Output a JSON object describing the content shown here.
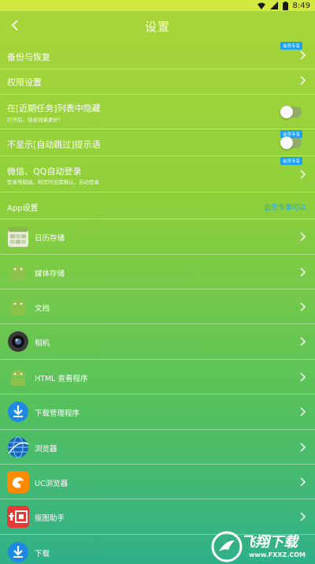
{
  "status": {
    "time": "8:49",
    "icons": [
      "wifi-icon",
      "signal-icon",
      "battery-icon"
    ]
  },
  "header": {
    "title": "设置"
  },
  "settings": [
    {
      "label": "备份与恢复",
      "badge": "会员专享"
    },
    {
      "label": "权限设置"
    },
    {
      "label": "在[近期任务]列表中隐藏",
      "sub": "打开后，隐身效果更好！"
    },
    {
      "label": "不显示[自动跳过]提示语",
      "badge": "会员专享"
    },
    {
      "label": "微信、QQ自动登录",
      "sub": "登录电脑端，网页时无需确认，自动登录",
      "badge": "会员专享"
    }
  ],
  "app_section": {
    "label": "App设置",
    "link": "会员专享可以"
  },
  "apps": [
    {
      "label": "日历存储",
      "icon": "calendar-icon"
    },
    {
      "label": "媒体存储",
      "icon": "android-icon"
    },
    {
      "label": "文档",
      "icon": "android-icon"
    },
    {
      "label": "相机",
      "icon": "camera-icon"
    },
    {
      "label": "HTML 查看程序",
      "icon": "android-icon"
    },
    {
      "label": "下载管理程序",
      "icon": "download-icon"
    },
    {
      "label": "浏览器",
      "icon": "globe-icon"
    },
    {
      "label": "UC浏览器",
      "icon": "uc-browser-icon"
    },
    {
      "label": "抠图助手",
      "icon": "cutout-icon"
    },
    {
      "label": "下载",
      "icon": "download-icon"
    }
  ],
  "watermark": {
    "text": "飞翔下载",
    "url": "www.FXXZ.COM"
  },
  "colors": {
    "accent": "#1ea0f0",
    "statusbar": "#d4e842"
  }
}
